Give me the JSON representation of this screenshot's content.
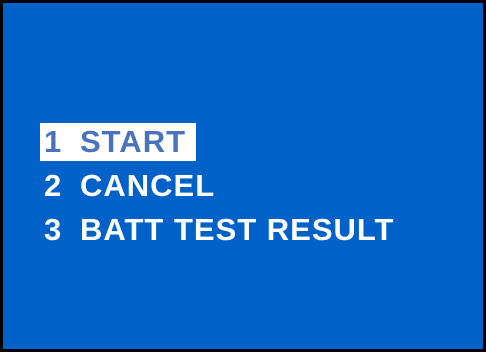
{
  "colors": {
    "background": "#0062c8",
    "border": "#000000",
    "text": "#ffffff",
    "highlight_background": "#ffffff",
    "highlight_text": "#4a73bd"
  },
  "menu": {
    "selected_index": 0,
    "items": [
      {
        "number": "1",
        "label": "START"
      },
      {
        "number": "2",
        "label": "CANCEL"
      },
      {
        "number": "3",
        "label": "BATT TEST RESULT"
      }
    ]
  }
}
